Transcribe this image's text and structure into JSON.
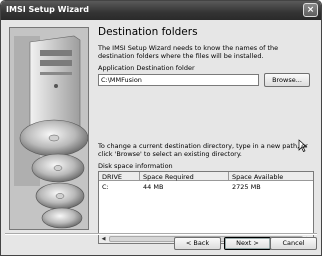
{
  "window": {
    "title": "IMSI Setup Wizard",
    "close_glyph": "×"
  },
  "page": {
    "heading": "Destination folders",
    "description": "The IMSI Setup Wizard needs to know the names of the destination folders where the files will be installed.",
    "app_dest_label": "Application Destination folder",
    "app_dest_value": "C:\\MMFusion",
    "browse_label": "Browse...",
    "change_hint": "To change a current destination directory, type in a new path, or click 'Browse' to select an existing directory.",
    "disk_space_label": "Disk space information"
  },
  "disk_table": {
    "columns": [
      "DRIVE",
      "Space Required",
      "Space Available"
    ],
    "rows": [
      {
        "drive": "C:",
        "required": "44 MB",
        "available": "2725 MB"
      }
    ]
  },
  "buttons": {
    "back": "< Back",
    "next": "Next >",
    "cancel": "Cancel"
  },
  "icons": [
    "close-icon",
    "mouse-pointer-icon",
    "scroll-left-icon",
    "scroll-right-icon"
  ]
}
